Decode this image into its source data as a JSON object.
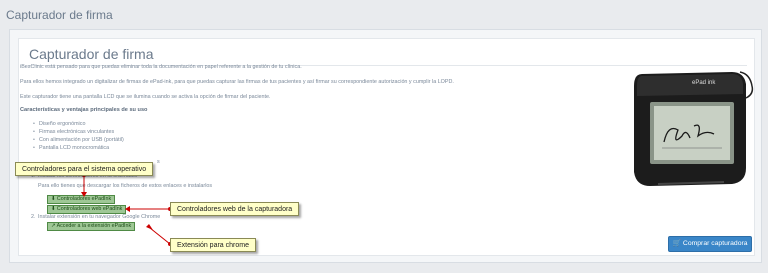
{
  "page": {
    "title": "Capturador de firma"
  },
  "panel": {
    "title": "Capturador de firma",
    "intro": "iBesClinic está pensado para que puedas eliminar toda la documentación en papel referente a la gestión de tu clínica.",
    "paragraph2": "Para ellos hemos integrado un digitalizar de firmas de ePad-ink, para que puedas capturar las firmas de tus pacientes y así firmar su correspondiente autorización y cumplir la LOPD.",
    "paragraph3": "Este capturador tiene una pantalla LCD que se ilumina cuando se activa la opción de firmar del paciente.",
    "features_heading": "Características y ventajas principales de su uso",
    "features": [
      "Diseño ergonómico",
      "Firmas electrónicas vinculantes",
      "Con alimentación por USB (portátil)",
      "Pantalla LCD monocromática"
    ],
    "install_partial": "s",
    "step1_label": "1.",
    "step1_text": "Instalar los controladores en tu ordenador",
    "step1_sub": "Para ello tienes que descargar los ficheros de estos enlaces e instalarlos",
    "links": {
      "controllers": "Controladores ePadInk",
      "web_controllers": "Controladores web ePadInk",
      "extension": "Acceder a la extensión ePadInk"
    },
    "step2_label": "2.",
    "step2_text": "Instalar extensión en tu navegador Google Chrome",
    "buy_button": "Comprar capturadora",
    "device_brand": "ePad ink"
  },
  "callouts": {
    "os": "Controladores para el sistema operativo",
    "web": "Controladores web de la capturadora",
    "chrome": "Extensión para chrome"
  },
  "colors": {
    "accent_blue": "#3a86c8",
    "link_green": "#9ec795",
    "callout_yellow": "#ffffc8",
    "arrow_red": "#cc0000"
  }
}
